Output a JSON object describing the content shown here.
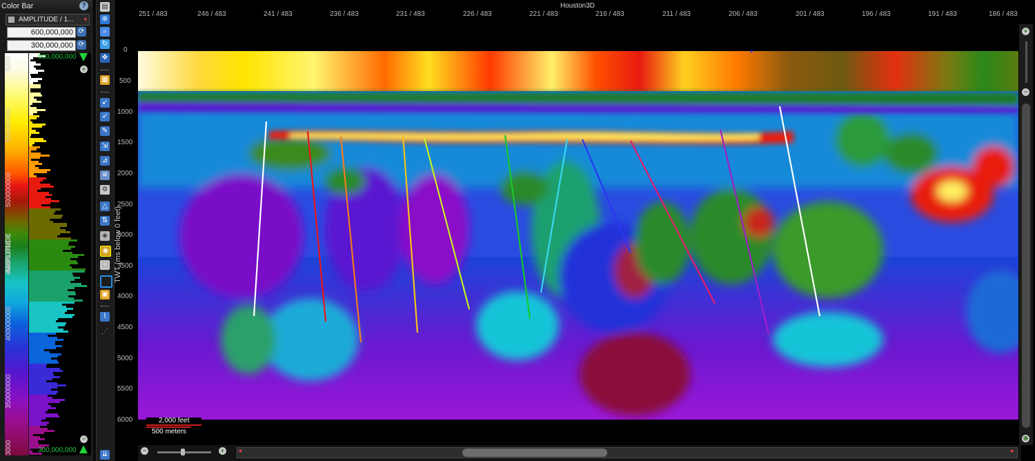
{
  "colorbar": {
    "title": "Color Bar",
    "help_icon": "?",
    "attribute_select": "AMPLITUDE / 1...",
    "max_value": "600,000,000",
    "min_value": "300,000,000",
    "max_marker_label": "600,000,000",
    "min_marker_label": "300,000,000",
    "axis_label": "AMPLITUDE",
    "ticks": [
      "6000",
      "550000000",
      "500000000",
      "450000000",
      "400000000",
      "350000000",
      "3000"
    ],
    "colors": {
      "marker": "#21d23c",
      "refresh": "#3d6fb0"
    }
  },
  "view": {
    "title": "Houston3D",
    "x_ticks": [
      "251 / 483",
      "246 / 483",
      "241 / 483",
      "236 / 483",
      "231 / 483",
      "226 / 483",
      "221 / 483",
      "216 / 483",
      "211 / 483",
      "206 / 483",
      "201 / 483",
      "196 / 483",
      "191 / 483",
      "186 / 483"
    ],
    "y_axis_label": "TWT (ms below 0 feet)",
    "y_ticks": [
      "0",
      "500",
      "1000",
      "1500",
      "2000",
      "2500",
      "3000",
      "3500",
      "4000",
      "4500",
      "5000",
      "5500",
      "6000"
    ],
    "scale_feet": "2,000 feet",
    "scale_meters": "500 meters",
    "fault_colors": [
      "#ffffff",
      "#e81818",
      "#f07a1e",
      "#f5c21a",
      "#c6f020",
      "#18c828",
      "#38d8f0",
      "#2a36f0",
      "#e21c6c",
      "#a01ec8",
      "#ffffff"
    ]
  }
}
